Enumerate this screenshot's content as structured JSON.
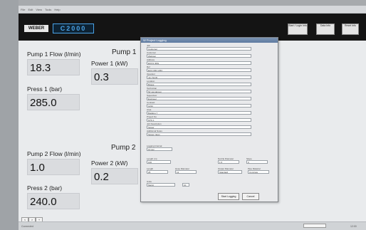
{
  "app": {
    "brand": "WEBER",
    "model": "C2000",
    "menu": [
      "File",
      "Edit",
      "View",
      "Tools",
      "Help"
    ],
    "top_buttons": [
      {
        "label": "Start / Login\nInfo"
      },
      {
        "label": "Data\nInfo"
      },
      {
        "label": "Reset\nInfo"
      }
    ]
  },
  "readouts": {
    "pump1_title": "Pump 1",
    "pump1_flow_label": "Pump 1 Flow (l/min)",
    "pump1_flow_value": "18.3",
    "pump1_power_label": "Power 1 (kW)",
    "pump1_power_value": "0.3",
    "press1_label": "Press 1 (bar)",
    "press1_value": "285.0",
    "pump2_title": "Pump 2",
    "pump2_flow_label": "Pump 2 Flow (l/min)",
    "pump2_flow_value": "1.0",
    "pump2_power_label": "Power 2 (kW)",
    "pump2_power_value": "0.2",
    "press2_label": "Press 2 (bar)",
    "press2_value": "240.0"
  },
  "dialog": {
    "title": "W Project Logging",
    "fields": [
      {
        "label": "Job",
        "value": "Customer"
      },
      {
        "label": "Customer",
        "value": "Webster"
      },
      {
        "label": "Address",
        "value": "ECO1 4DG"
      },
      {
        "label": "Ref",
        "value": "ECO 000 1234"
      },
      {
        "label": "Operator",
        "value": "Jon Smith"
      },
      {
        "label": "Location",
        "value": "Bristol"
      },
      {
        "label": "Technician",
        "value": "Mr Henderson"
      },
      {
        "label": "Supervisor",
        "value": "Engineer"
      },
      {
        "label": "Contract",
        "value": "1234"
      },
      {
        "label": "Area",
        "value": "Building 7"
      },
      {
        "label": "Project No",
        "value": "NTS 1"
      },
      {
        "label": "Job Description",
        "value": "Sewer"
      },
      {
        "label": "Additional Notes",
        "value": "Sewer clean"
      }
    ],
    "log_label": "Logging Interval",
    "log_value": "10 sec",
    "settings": [
      {
        "label": "Length (m)",
        "value": "100"
      },
      {
        "label": "Nozzle Diameter",
        "value": "1.5"
      },
      {
        "label": "Length",
        "value": "25"
      },
      {
        "label": "Hose Diameter",
        "value": "12"
      },
      {
        "label": "Slope",
        "value": "0"
      },
      {
        "label": "Output Diameter",
        "value": "Standard"
      },
      {
        "label": "Flow",
        "value": "10"
      },
      {
        "label": "Pipe Material",
        "value": "Concrete"
      }
    ],
    "units_label": "Units",
    "units_value": "Metric",
    "start_button": "Start Logging",
    "cancel_button": "Cancel"
  },
  "footer": {
    "status": "Connected",
    "nav_buttons": [
      "<",
      ">",
      "+"
    ],
    "time": "12:00"
  }
}
